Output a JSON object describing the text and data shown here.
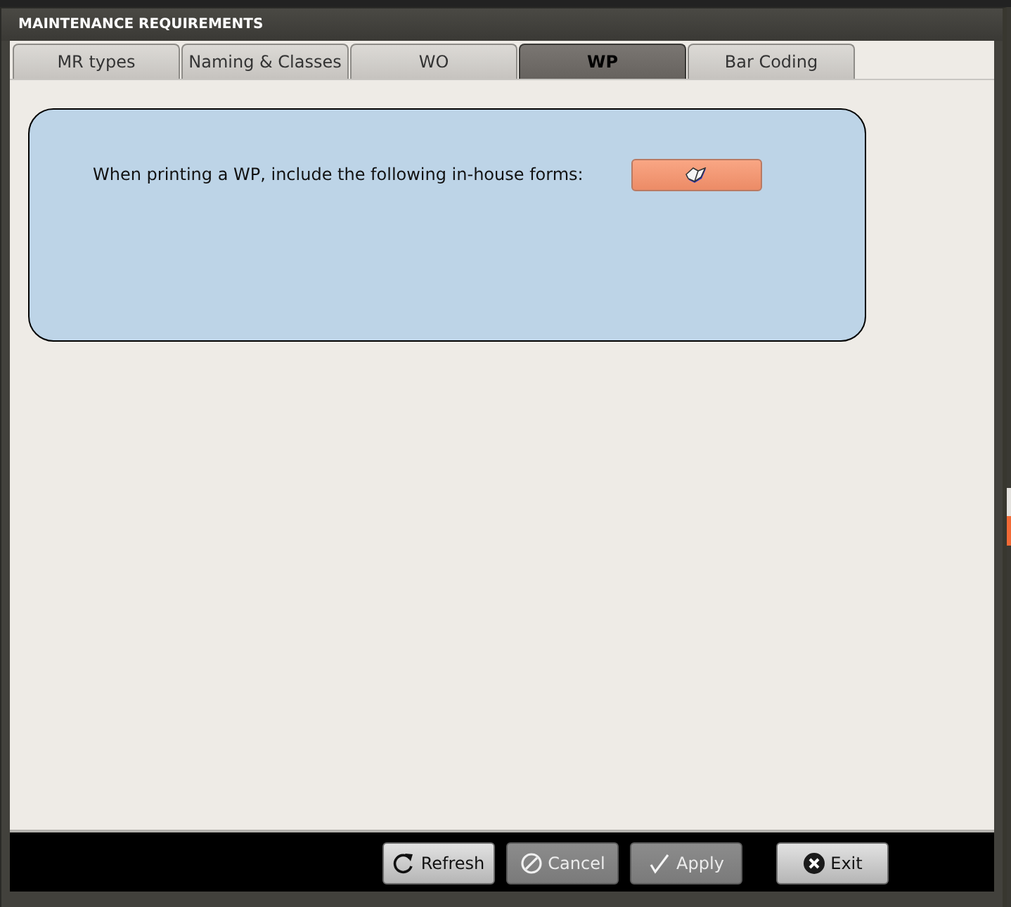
{
  "window": {
    "title": "MAINTENANCE REQUIREMENTS"
  },
  "tabs": [
    {
      "label": "MR types",
      "selected": false
    },
    {
      "label": "Naming & Classes",
      "selected": false
    },
    {
      "label": "WO",
      "selected": false
    },
    {
      "label": "WP",
      "selected": true
    },
    {
      "label": "Bar Coding",
      "selected": false
    }
  ],
  "panel": {
    "text": "When printing a WP, include the following in-house forms:"
  },
  "buttons": [
    {
      "label": "Refresh",
      "kind": "refresh",
      "disabled": false
    },
    {
      "label": "Cancel",
      "kind": "cancel",
      "disabled": true
    },
    {
      "label": "Apply",
      "kind": "apply",
      "disabled": true
    },
    {
      "label": "Exit",
      "kind": "exit",
      "disabled": false
    }
  ]
}
